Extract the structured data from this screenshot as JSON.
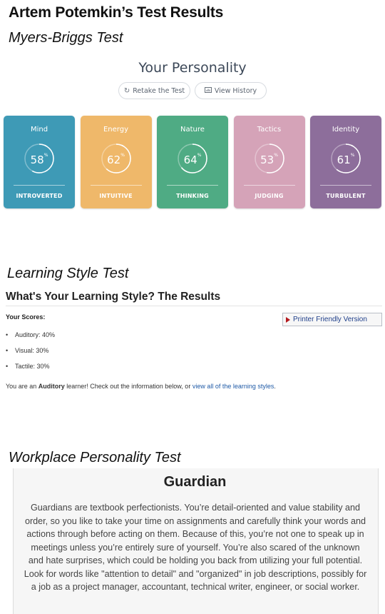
{
  "page": {
    "title": "Artem Potemkin’s Test Results"
  },
  "myers_briggs": {
    "heading": "Myers-Briggs Test",
    "title": "Your Personality",
    "retake_label": "Retake the Test",
    "history_label": "View History",
    "cards": [
      {
        "label": "Mind",
        "percent": 58,
        "trait": "INTROVERTED",
        "color": "#3e9ab6"
      },
      {
        "label": "Energy",
        "percent": 62,
        "trait": "INTUITIVE",
        "color": "#efb86a"
      },
      {
        "label": "Nature",
        "percent": 64,
        "trait": "THINKING",
        "color": "#4fab84"
      },
      {
        "label": "Tactics",
        "percent": 53,
        "trait": "JUDGING",
        "color": "#d5a3b8"
      },
      {
        "label": "Identity",
        "percent": 61,
        "trait": "TURBULENT",
        "color": "#8d6e9b"
      }
    ]
  },
  "learning_style": {
    "heading": "Learning Style Test",
    "title": "What's Your Learning Style? The Results",
    "scores_label": "Your Scores:",
    "printer_label": "Printer Friendly Version",
    "scores": [
      "Auditory: 40%",
      "Visual: 30%",
      "Tactile: 30%"
    ],
    "summary_prefix": "You are an ",
    "summary_type": "Auditory",
    "summary_middle": " learner! Check out the information below, or ",
    "summary_link": "view all of the learning styles",
    "summary_end": "."
  },
  "workplace": {
    "heading": "Workplace Personality Test",
    "title": "Guardian",
    "description": "Guardians are textbook perfectionists. You’re detail-oriented and value stability and order, so you like to take your time on assignments and carefully think your words and actions through before acting on them. Because of this, you’re not one to speak up in meetings unless you’re entirely sure of yourself. You’re also scared of the unknown and hate surprises, which could be holding you back from utilizing your full potential. Look for words like \"attention to detail\" and \"organized\" in job descriptions, possibly for a job as a project manager, accountant, technical writer, engineer, or social worker."
  }
}
